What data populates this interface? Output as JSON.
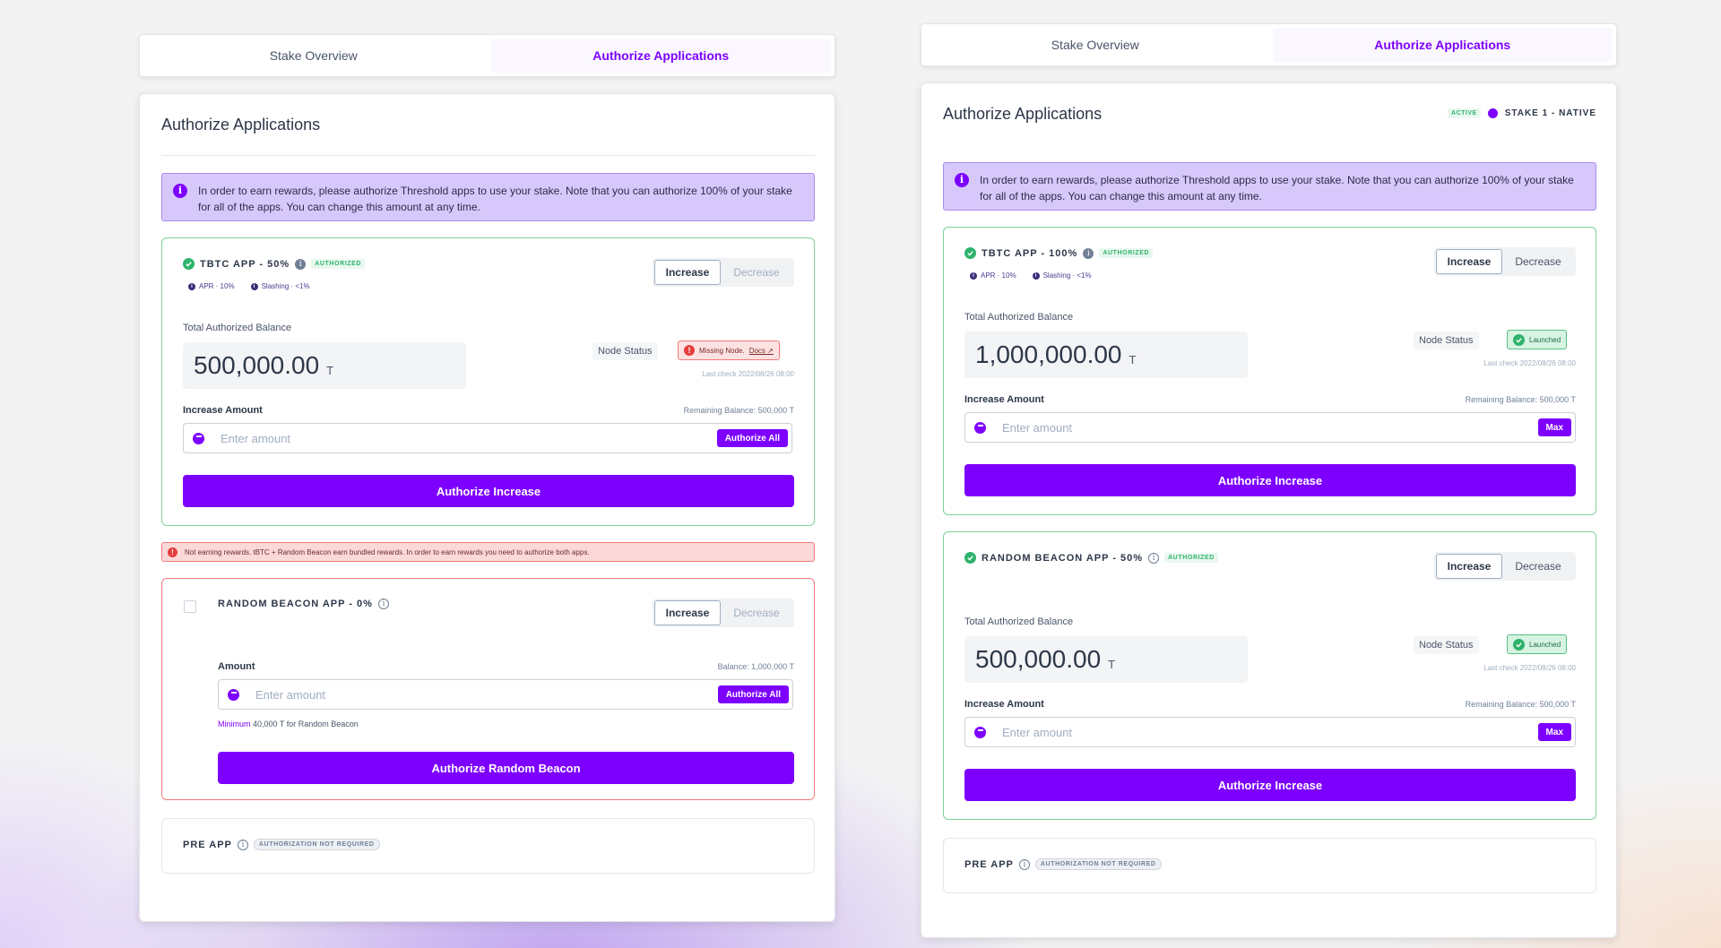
{
  "left": {
    "tabs": [
      "Stake Overview",
      "Authorize Applications"
    ],
    "title": "Authorize Applications",
    "info_alert": "In order to earn rewards, please authorize Threshold apps to use your stake. Note that you can authorize 100% of your stake for all of the apps. You can change this amount at any time.",
    "tbtc": {
      "name": "TBTC APP - 50%",
      "badge": "AUTHORIZED",
      "apr": "APR · 10%",
      "slashing": "Slashing · <1%",
      "increase": "Increase",
      "decrease": "Decrease",
      "total_label": "Total Authorized Balance",
      "balance": "500,000.00",
      "unit": "T",
      "node_status_label": "Node Status",
      "node_status": "Missing Node.",
      "docs": "Docs ↗",
      "last_check": "Last check 2022/08/26 08:00",
      "increase_amount_label": "Increase Amount",
      "remaining": "Remaining Balance: 500,000 T",
      "placeholder": "Enter amount",
      "authorize_all": "Authorize All",
      "submit": "Authorize Increase"
    },
    "error_alert": "Not earning rewards. tBTC + Random Beacon earn bundled rewards. In order to earn rewards you need to authorize both apps.",
    "beacon": {
      "name": "RANDOM BEACON APP - 0%",
      "increase": "Increase",
      "decrease": "Decrease",
      "amount_label": "Amount",
      "balance_label": "Balance: 1,000,000 T",
      "placeholder": "Enter amount",
      "authorize_all": "Authorize All",
      "minimum_hl": "Minimum",
      "minimum_rest": " 40,000 T for Random Beacon",
      "submit": "Authorize Random Beacon"
    },
    "pre": {
      "name": "PRE APP",
      "badge": "AUTHORIZATION NOT REQUIRED"
    }
  },
  "right": {
    "tabs": [
      "Stake Overview",
      "Authorize Applications"
    ],
    "title": "Authorize Applications",
    "stake_status": "ACTIVE",
    "stake_name": "STAKE 1 - NATIVE",
    "info_alert": "In order to earn rewards, please authorize Threshold apps to use your stake. Note that you can authorize 100% of your stake for all of the apps. You can change this amount at any time.",
    "tbtc": {
      "name": "TBTC APP - 100%",
      "badge": "AUTHORIZED",
      "apr": "APR · 10%",
      "slashing": "Slashing · <1%",
      "increase": "Increase",
      "decrease": "Decrease",
      "total_label": "Total Authorized Balance",
      "balance": "1,000,000.00",
      "unit": "T",
      "node_status_label": "Node Status",
      "node_status": "Launched",
      "last_check": "Last check 2022/08/26 08:00",
      "increase_amount_label": "Increase Amount",
      "remaining": "Remaining Balance: 500,000 T",
      "placeholder": "Enter amount",
      "max": "Max",
      "submit": "Authorize Increase"
    },
    "beacon": {
      "name": "RANDOM BEACON APP - 50%",
      "badge": "AUTHORIZED",
      "increase": "Increase",
      "decrease": "Decrease",
      "total_label": "Total Authorized Balance",
      "balance": "500,000.00",
      "unit": "T",
      "node_status_label": "Node Status",
      "node_status": "Launched",
      "last_check": "Last check 2022/08/26 08:00",
      "increase_amount_label": "Increase Amount",
      "remaining": "Remaining Balance: 500,000 T",
      "placeholder": "Enter amount",
      "max": "Max",
      "submit": "Authorize Increase"
    },
    "pre": {
      "name": "PRE APP",
      "badge": "AUTHORIZATION NOT REQUIRED"
    }
  },
  "colors": {
    "brand": "#7d00ff",
    "success": "#2fb36b",
    "error": "#e53e3e",
    "info_bg": "#d7c8fb"
  }
}
